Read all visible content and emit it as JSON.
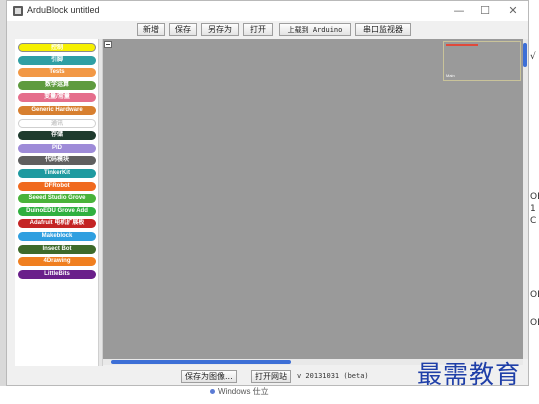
{
  "window": {
    "title": "ArduBlock untitled",
    "minimize": "—",
    "maximize": "☐",
    "close": "✕"
  },
  "toolbar": {
    "buttons": [
      "新增",
      "保存",
      "另存为",
      "打开",
      "上载到 Arduino",
      "串口监视器"
    ]
  },
  "palette": {
    "items": [
      {
        "label": "控制",
        "color": "#f6f000"
      },
      {
        "label": "引脚",
        "color": "#2f9fa4"
      },
      {
        "label": "Tests",
        "color": "#f29845"
      },
      {
        "label": "数学运算",
        "color": "#5f9b3f"
      },
      {
        "label": "变量/常量",
        "color": "#e56e8c"
      },
      {
        "label": "Generic Hardware",
        "color": "#d77f2f"
      },
      {
        "label": "通讯",
        "color": "#ffffff"
      },
      {
        "label": "存储",
        "color": "#1f3b2e"
      },
      {
        "label": "PID",
        "color": "#9e8bd8"
      },
      {
        "label": "代码模块",
        "color": "#5f5f5f"
      },
      {
        "label": "TinkerKit",
        "color": "#1f9aa0"
      },
      {
        "label": "DFRobot",
        "color": "#f06a1f"
      },
      {
        "label": "Seeed Studio Grove",
        "color": "#49b33a"
      },
      {
        "label": "DuinoEDU Grove Add",
        "color": "#2fb03f"
      },
      {
        "label": "Adafruit 电机扩展板",
        "color": "#c42424"
      },
      {
        "label": "Makeblock",
        "color": "#2f9fe0"
      },
      {
        "label": "Insect Bot",
        "color": "#3e6a2a"
      },
      {
        "label": "4Drawing",
        "color": "#f07f1f"
      },
      {
        "label": "LittleBits",
        "color": "#6a1f8a"
      }
    ]
  },
  "statusbar": {
    "save_image": "保存为图像...",
    "open_site": "打开网站",
    "version": "v 20131031 (beta)"
  },
  "background": {
    "taskbar_item": "Windows 仕立",
    "right_marks": [
      "√",
      "OE",
      "1",
      "C",
      "OE",
      "OE"
    ]
  },
  "watermark": "最需教育",
  "colors": {
    "canvas": "#9a9a9a",
    "scroll_thumb": "#3d6fd6",
    "watermark": "#1f3fa8"
  }
}
